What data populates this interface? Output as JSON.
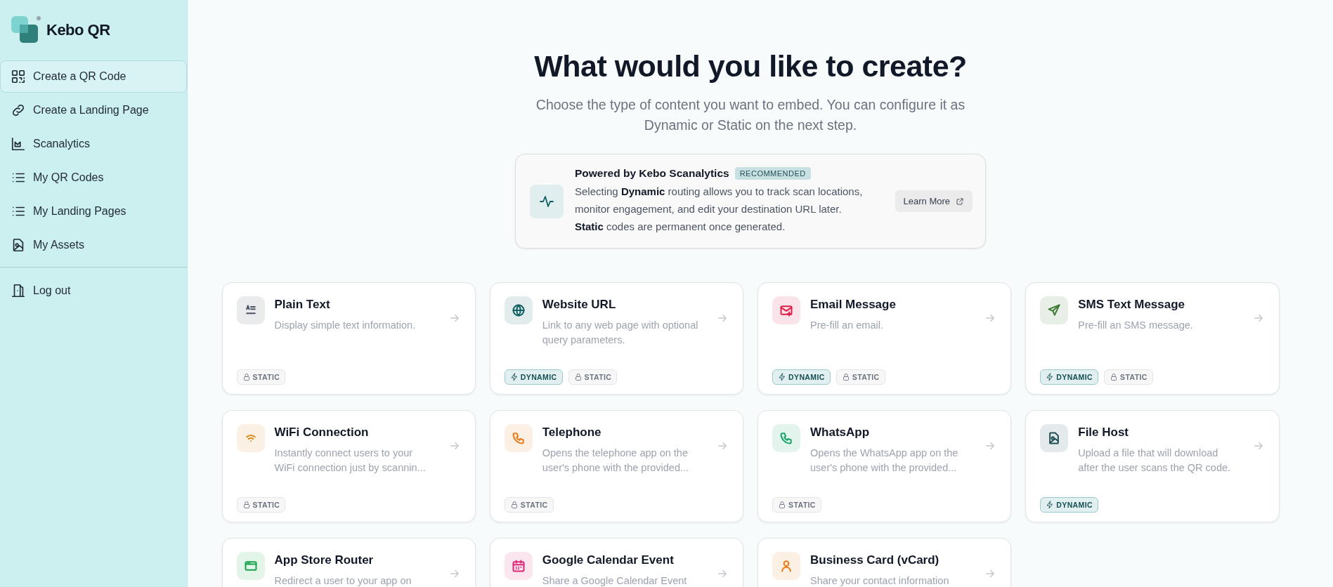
{
  "sidebar": {
    "brand": "Kebo QR",
    "items": [
      {
        "label": "Create a QR Code",
        "selected": true
      },
      {
        "label": "Create a Landing Page",
        "selected": false
      },
      {
        "label": "Scanalytics",
        "selected": false
      },
      {
        "label": "My QR Codes",
        "selected": false
      },
      {
        "label": "My Landing Pages",
        "selected": false
      },
      {
        "label": "My Assets",
        "selected": false
      }
    ],
    "logout": "Log out"
  },
  "main": {
    "title": "What would you like to create?",
    "subtitle": "Choose the type of content you want to embed. You can configure it as Dynamic or Static on the next step.",
    "info": {
      "title": "Powered by Kebo Scanalytics",
      "badge": "RECOMMENDED",
      "text": "Selecting **Dynamic** routing allows you to track scan locations, monitor engagement, and edit your destination URL later. **Static** codes are permanent once generated.",
      "button": "Learn More"
    },
    "cards": [
      {
        "title": "Plain Text",
        "description": "Display simple text information.",
        "color": "#4b5563",
        "badges": [
          {
            "kind": "static",
            "label": "STATIC"
          }
        ]
      },
      {
        "title": "Website URL",
        "description": "Link to any web page with optional query parameters.",
        "color": "#0f5f63",
        "badges": [
          {
            "kind": "dynamic",
            "label": "DYNAMIC"
          },
          {
            "kind": "static",
            "label": "STATIC"
          }
        ]
      },
      {
        "title": "Email Message",
        "description": "Pre-fill an email.",
        "color": "#e11d48",
        "badges": [
          {
            "kind": "dynamic",
            "label": "DYNAMIC"
          },
          {
            "kind": "static",
            "label": "STATIC"
          }
        ]
      },
      {
        "title": "SMS Text Message",
        "description": "Pre-fill an SMS message.",
        "color": "#3f7a35",
        "badges": [
          {
            "kind": "dynamic",
            "label": "DYNAMIC"
          },
          {
            "kind": "static",
            "label": "STATIC"
          }
        ]
      },
      {
        "title": "WiFi Connection",
        "description": "Instantly connect users to your WiFi connection just by scannin...",
        "color": "#d98a1a",
        "badges": [
          {
            "kind": "static",
            "label": "STATIC"
          }
        ]
      },
      {
        "title": "Telephone",
        "description": "Opens the telephone app on the user's phone with the provided...",
        "color": "#ea7a1a",
        "badges": [
          {
            "kind": "static",
            "label": "STATIC"
          }
        ]
      },
      {
        "title": "WhatsApp",
        "description": "Opens the WhatsApp app on the user's phone with the provided...",
        "color": "#16a36a",
        "badges": [
          {
            "kind": "static",
            "label": "STATIC"
          }
        ]
      },
      {
        "title": "File Host",
        "description": "Upload a file that will download after the user scans the QR code.",
        "color": "#1f4f55",
        "badges": [
          {
            "kind": "dynamic",
            "label": "DYNAMIC"
          }
        ]
      },
      {
        "title": "App Store Router",
        "description": "Redirect a user to your app on",
        "color": "#16a34a"
      },
      {
        "title": "Google Calendar Event",
        "description": "Share a Google Calendar Event",
        "color": "#db2777"
      },
      {
        "title": "Business Card (vCard)",
        "description": "Share your contact information",
        "color": "#ea7a1a"
      }
    ]
  }
}
